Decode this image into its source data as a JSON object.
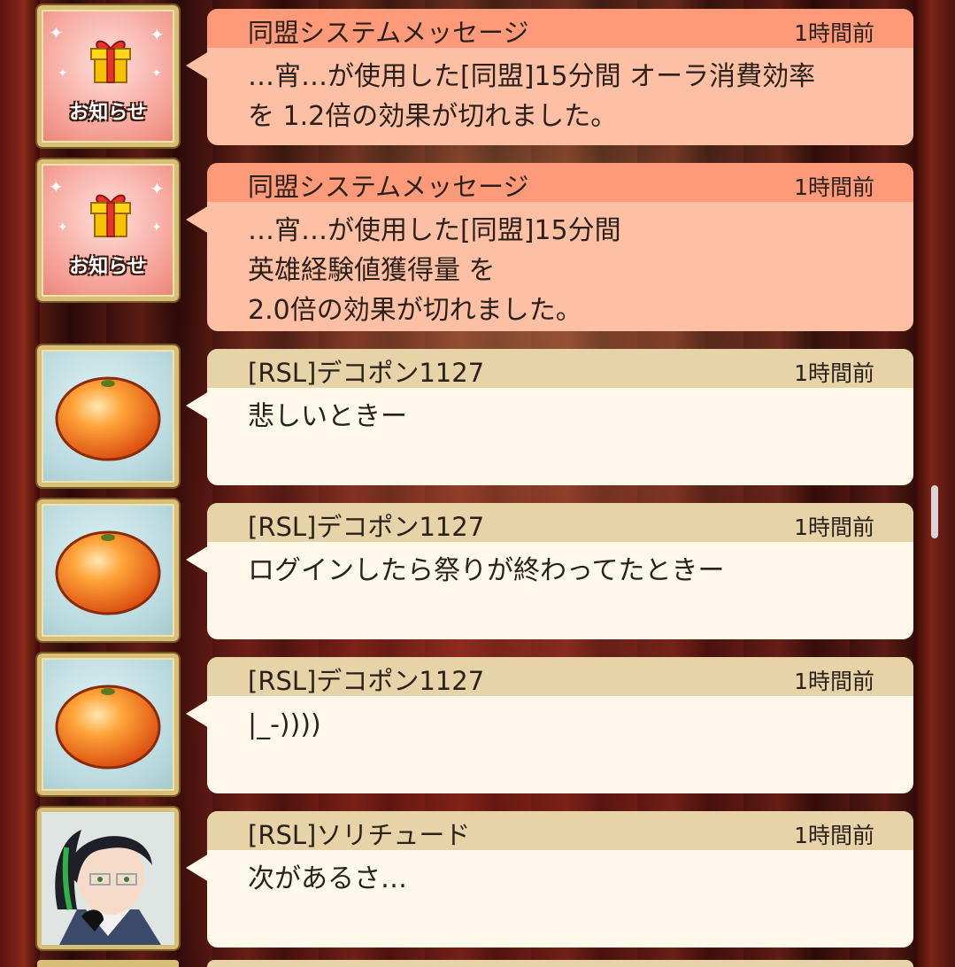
{
  "messages": [
    {
      "avatar": "notice-gift-icon",
      "avatar_label": "お知らせ",
      "sender": "同盟システムメッセージ",
      "time": "1時間前",
      "lines": [
        "…宵…が使用した[同盟]15分間 オーラ消費効率",
        "を 1.2倍の効果が切れました。"
      ]
    },
    {
      "avatar": "notice-gift-icon",
      "avatar_label": "お知らせ",
      "sender": "同盟システムメッセージ",
      "time": "1時間前",
      "lines": [
        "…宵…が使用した[同盟]15分間",
        "英雄経験値獲得量 を",
        "2.0倍の効果が切れました。"
      ]
    },
    {
      "avatar": "orange-icon",
      "sender": "[RSL]デコポン1127",
      "time": "1時間前",
      "lines": [
        "悲しいときー"
      ]
    },
    {
      "avatar": "orange-icon",
      "sender": "[RSL]デコポン1127",
      "time": "1時間前",
      "lines": [
        "ログインしたら祭りが終わってたときー"
      ]
    },
    {
      "avatar": "orange-icon",
      "sender": "[RSL]デコポン1127",
      "time": "1時間前",
      "lines": [
        "|_-))))"
      ]
    },
    {
      "avatar": "character-portrait",
      "sender": "[RSL]ソリチュード",
      "time": "1時間前",
      "lines": [
        "次があるさ…"
      ]
    }
  ],
  "colors": {
    "system_header": "#fc9a7a",
    "system_body": "#fec0a4",
    "chat_header": "#e6d4a8",
    "chat_body": "#fdf8ea",
    "avatar_frame": "#d8bf78"
  }
}
